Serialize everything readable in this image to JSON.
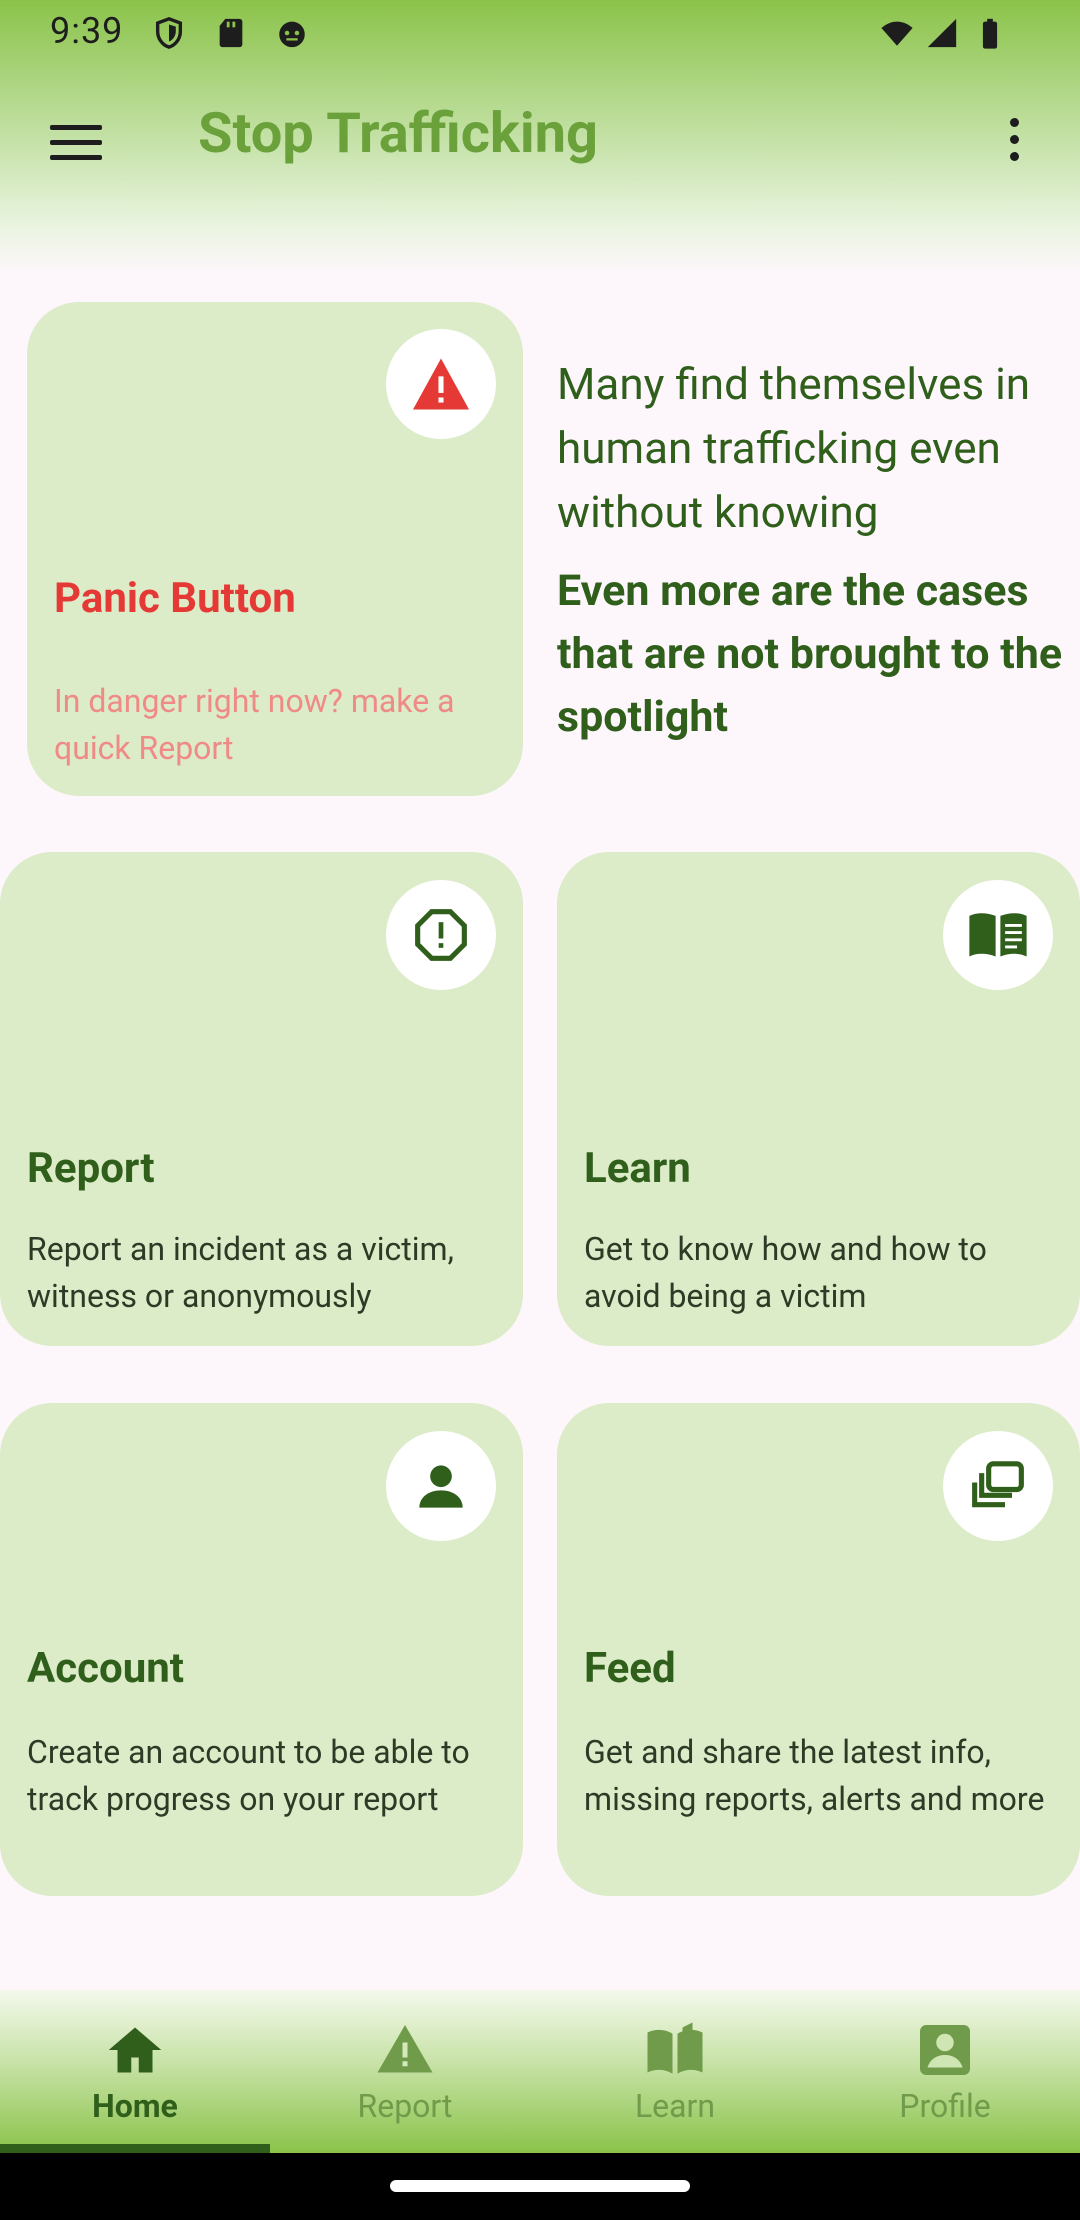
{
  "status_bar": {
    "time": "9:39"
  },
  "app_bar": {
    "title": "Stop Trafficking"
  },
  "panic_card": {
    "title": "Panic Button",
    "description": "In danger right now? make a quick Report",
    "icon": "warning-icon"
  },
  "promo": {
    "line1": "Many find themselves in human trafficking even without knowing",
    "line2": "Even more are the cases that are not brought to the spotlight"
  },
  "cards": [
    {
      "title": "Report",
      "description": "Report an incident as a victim, witness or anonymously",
      "icon": "report-icon"
    },
    {
      "title": "Learn",
      "description": "Get to know how and how to avoid being a victim",
      "icon": "book-icon"
    },
    {
      "title": "Account",
      "description": "Create an account to be able to track progress on your report",
      "icon": "person-icon"
    },
    {
      "title": "Feed",
      "description": "Get and share the latest info, missing reports, alerts and more",
      "icon": "feed-icon"
    }
  ],
  "bottom_nav": [
    {
      "label": "Home",
      "active": true
    },
    {
      "label": "Report",
      "active": false
    },
    {
      "label": "Learn",
      "active": false
    },
    {
      "label": "Profile",
      "active": false
    }
  ],
  "colors": {
    "primary": "#2f5f1b",
    "accent": "#6aa13a",
    "danger": "#e53935",
    "card": "#dcebc8"
  }
}
